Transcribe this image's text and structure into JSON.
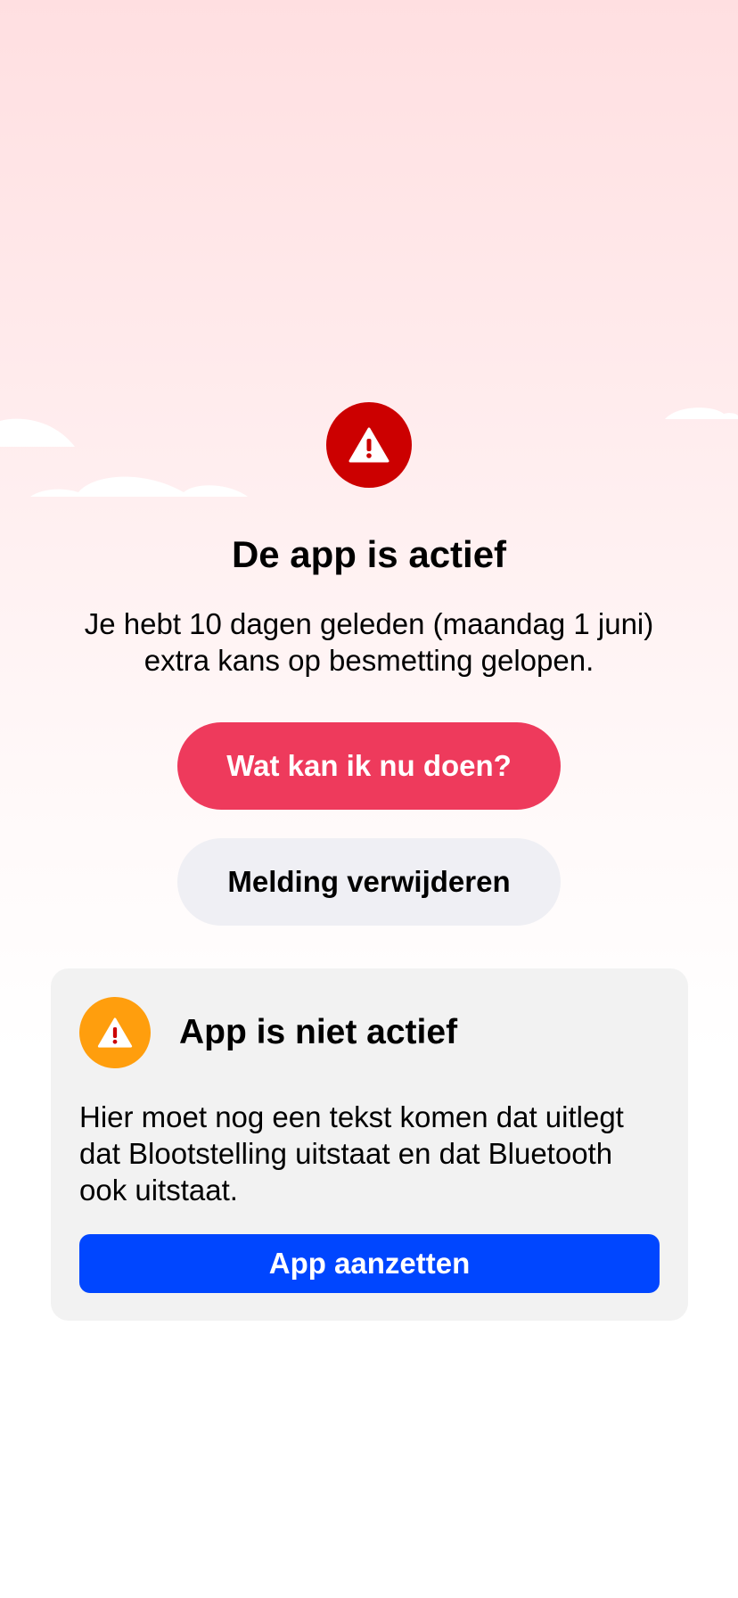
{
  "colors": {
    "hero_icon_bg": "#CC0000",
    "primary_button": "#EE3A5C",
    "secondary_button": "#EFEFF4",
    "card_bg": "#F2F2F2",
    "card_icon_bg": "#FF9E0D",
    "card_button": "#0046FF"
  },
  "hero": {
    "icon": "warning-icon",
    "title": "De app is actief",
    "text": "Je hebt 10 dagen geleden (maandag 1 juni) extra kans op besmetting gelopen.",
    "primary_button_label": "Wat kan ik nu doen?",
    "secondary_button_label": "Melding verwijderen"
  },
  "status_card": {
    "icon": "warning-icon",
    "title": "App is niet actief",
    "text": "Hier moet nog een tekst komen dat uitlegt dat Blootstelling uitstaat en dat Bluetooth ook uitstaat.",
    "button_label": "App aanzetten"
  }
}
